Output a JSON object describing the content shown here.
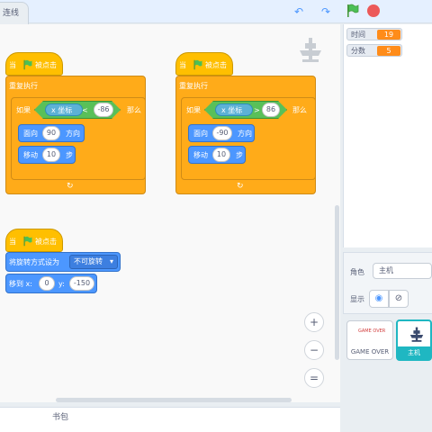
{
  "topbar": {
    "tab_partial_label": "连线"
  },
  "colors": {
    "events": "#ffbf00",
    "control": "#ffab19",
    "motion": "#4c97ff",
    "sensing": "#5cb1d6",
    "operators": "#59c059",
    "monitor_value": "#ff8c1a",
    "selected": "#1fb7c2"
  },
  "script1": {
    "hat_when": "当",
    "hat_clicked": "被点击",
    "forever": "重复执行",
    "if": "如果",
    "then": "那么",
    "x_coord": "x 坐标",
    "operator": "<",
    "compare_value": "-86",
    "point_label": "面向",
    "point_value": "90",
    "point_dir": "方向",
    "move_label": "移动",
    "move_value": "10",
    "move_unit": "步"
  },
  "script2": {
    "hat_when": "当",
    "hat_clicked": "被点击",
    "forever": "重复执行",
    "if": "如果",
    "then": "那么",
    "x_coord": "x 坐标",
    "operator": ">",
    "compare_value": "86",
    "point_label": "面向",
    "point_value": "-90",
    "point_dir": "方向",
    "move_label": "移动",
    "move_value": "10",
    "move_unit": "步"
  },
  "script3": {
    "hat_when": "当",
    "hat_clicked": "被点击",
    "rotation_label": "将旋转方式设为",
    "rotation_value": "不可旋转",
    "goto_label": "移到 x:",
    "goto_x": "0",
    "goto_y_label": "y:",
    "goto_y": "-150"
  },
  "zoom": {
    "in": "+",
    "out": "−",
    "reset": "="
  },
  "backpack": {
    "label": "书包"
  },
  "monitors": [
    {
      "name": "时间",
      "value": "19"
    },
    {
      "name": "分数",
      "value": "5"
    }
  ],
  "sprite_info": {
    "sprite_label": "角色",
    "sprite_name": "主机",
    "show_label": "显示"
  },
  "sprites": [
    {
      "name": "GAME OVER",
      "thumb_text": "GAME OVER"
    },
    {
      "name": "主机"
    }
  ]
}
